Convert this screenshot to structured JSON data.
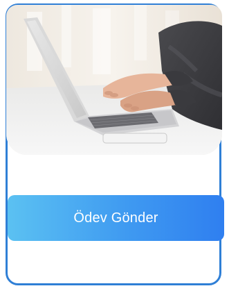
{
  "card": {
    "image_alt": "laptop-typing-photo",
    "button_label": "Ödev Gönder"
  },
  "colors": {
    "card_border": "#2f7fd6",
    "button_gradient_start": "#5bc1f2",
    "button_gradient_end": "#2f7ff0",
    "button_text": "#ffffff"
  }
}
